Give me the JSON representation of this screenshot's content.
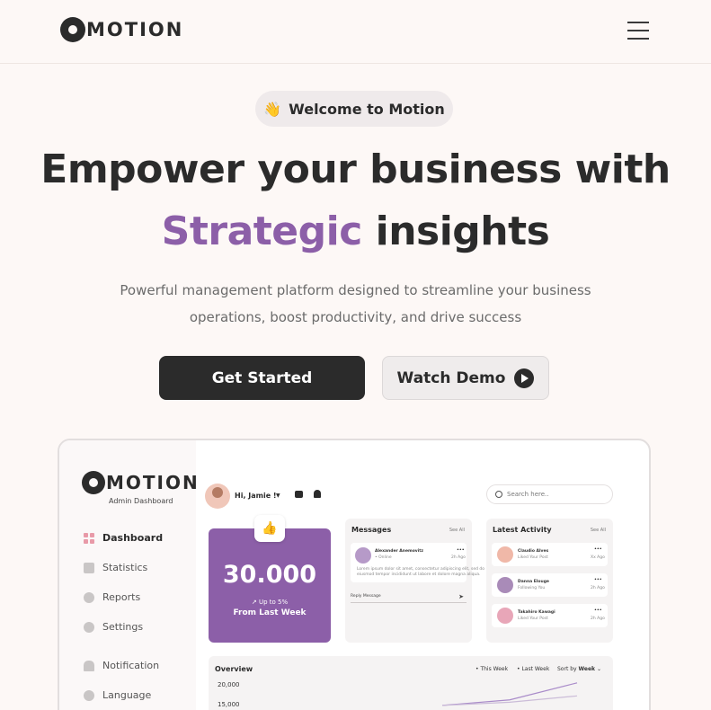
{
  "brand": {
    "name": "MOTION",
    "accent_color": "#8c5fa8",
    "dark_color": "#2b2b2b"
  },
  "header": {
    "menu_icon": "hamburger-icon"
  },
  "hero": {
    "badge_emoji": "👋",
    "badge_text": "Welcome to Motion",
    "headline_line1": "Empower your business with",
    "headline_accent": "Strategic",
    "headline_rest": " insights",
    "subtitle_line1": "Powerful management platform designed to streamline your business",
    "subtitle_line2": "operations, boost productivity, and drive success",
    "primary_cta": "Get Started",
    "secondary_cta": "Watch Demo"
  },
  "dashboard": {
    "logo": "MOTION",
    "logo_sub": "Admin Dashboard",
    "nav": [
      {
        "label": "Dashboard",
        "icon": "grid-icon",
        "active": true
      },
      {
        "label": "Statistics",
        "icon": "bar-chart-icon"
      },
      {
        "label": "Reports",
        "icon": "pie-chart-icon"
      },
      {
        "label": "Settings",
        "icon": "gear-icon"
      },
      {
        "label": "Notification",
        "icon": "bell-icon"
      },
      {
        "label": "Language",
        "icon": "globe-icon"
      }
    ],
    "greeting": "Hi, Jamie !",
    "search_placeholder": "Search here..",
    "stat": {
      "value": "30.000",
      "change": "Up to 5%",
      "period": "From Last Week"
    },
    "messages": {
      "title": "Messages",
      "see_all": "See All",
      "sender": "Alexander Anemovitz",
      "status": "• Online",
      "time": "2h Ago",
      "body_line1": "Lorem ipsum dolor sit amet, consectetur adipiscing elit, sed do",
      "body_line2": "eiusmod tempor incididunt ut labore et dolore magna aliqua.",
      "reply_label": "Reply Message"
    },
    "activity": {
      "title": "Latest Activity",
      "see_all": "See All",
      "items": [
        {
          "name": "Claudio Alves",
          "action": "Liked Your Post",
          "time": "Xx Ago"
        },
        {
          "name": "Danna Elouge",
          "action": "Following You",
          "time": "2h Ago"
        },
        {
          "name": "Takahiro Kawagi",
          "action": "Liked Your Post",
          "time": "2h Ago"
        }
      ]
    },
    "overview": {
      "title": "Overview",
      "legend_this": "• This Week",
      "legend_last": "• Last Week",
      "sort_label": "Sort by",
      "sort_value": "Week"
    }
  },
  "chart_data": {
    "type": "line",
    "title": "Overview",
    "y_ticks": [
      "20,000",
      "15,000"
    ],
    "series": [
      {
        "name": "This Week",
        "values": [
          14800,
          16200,
          20500
        ]
      },
      {
        "name": "Last Week",
        "values": [
          14800,
          15600,
          17200
        ]
      }
    ]
  }
}
